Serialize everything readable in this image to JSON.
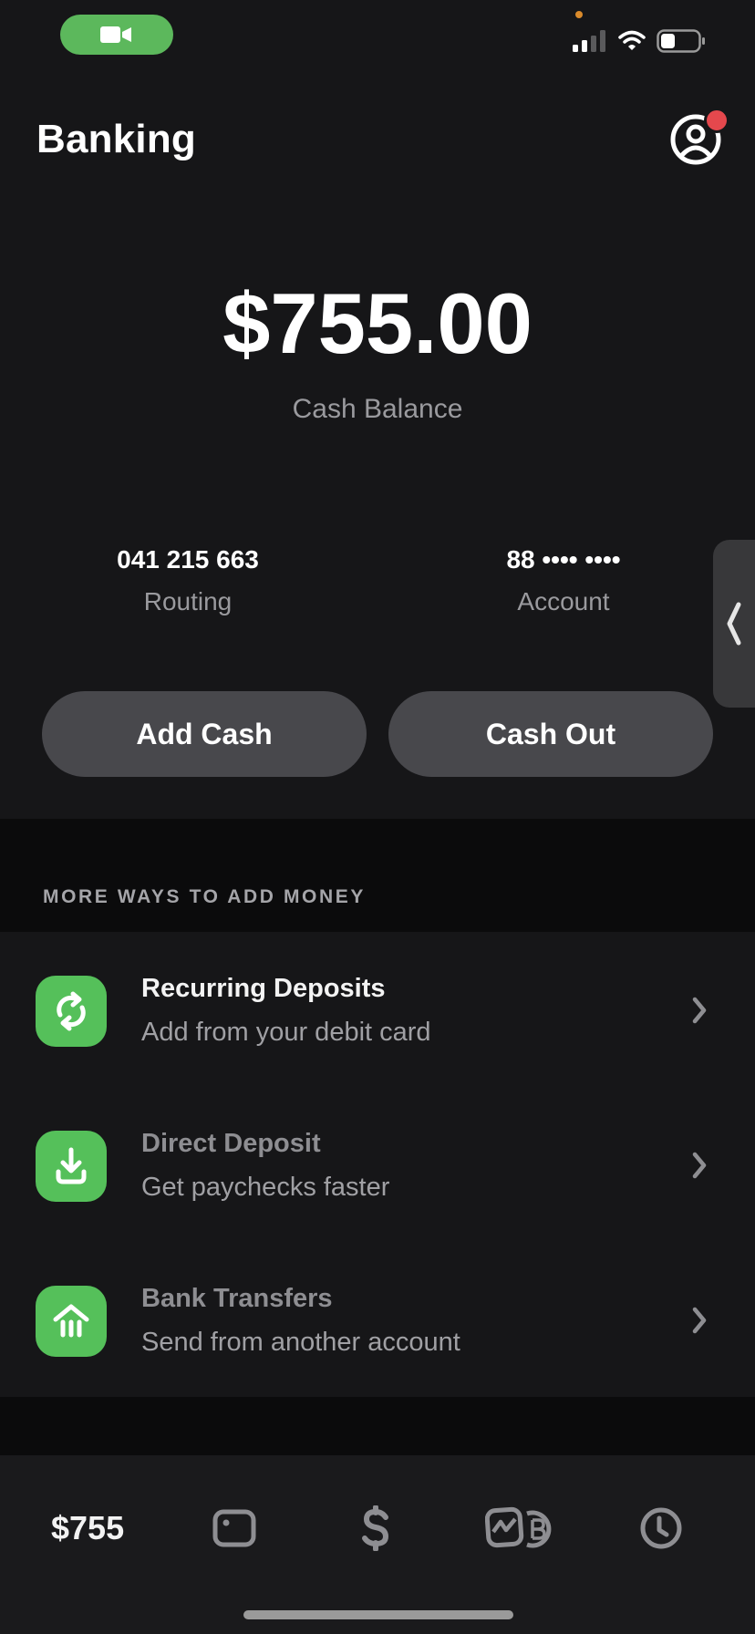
{
  "status_bar": {
    "facetime_indicator": "video-camera-icon",
    "signal": "cellular-signal-icon",
    "wifi": "wifi-icon",
    "battery": "battery-icon"
  },
  "header": {
    "title": "Banking",
    "profile_icon": "profile-icon",
    "has_notification": true
  },
  "balance": {
    "amount": "$755.00",
    "label": "Cash Balance"
  },
  "account_info": {
    "routing_value": "041 215 663",
    "routing_label": "Routing",
    "account_value": "88 •••• ••••",
    "account_label": "Account"
  },
  "actions": {
    "add_cash": "Add Cash",
    "cash_out": "Cash Out"
  },
  "more_ways": {
    "section_title": "MORE WAYS TO ADD MONEY",
    "items": [
      {
        "title": "Recurring Deposits",
        "subtitle": "Add from your debit card",
        "icon": "recurring-icon"
      },
      {
        "title": "Direct Deposit",
        "subtitle": "Get paychecks faster",
        "icon": "download-icon"
      },
      {
        "title": "Bank Transfers",
        "subtitle": "Send from another account",
        "icon": "bank-icon"
      }
    ]
  },
  "tabbar": {
    "balance_label": "$755",
    "tabs": [
      "card-icon",
      "dollar-icon",
      "investing-bitcoin-icon",
      "activity-clock-icon"
    ]
  },
  "colors": {
    "accent_green": "#55c05a",
    "notification_red": "#e5484d",
    "background": "#161618",
    "button_gray": "#48484c"
  }
}
